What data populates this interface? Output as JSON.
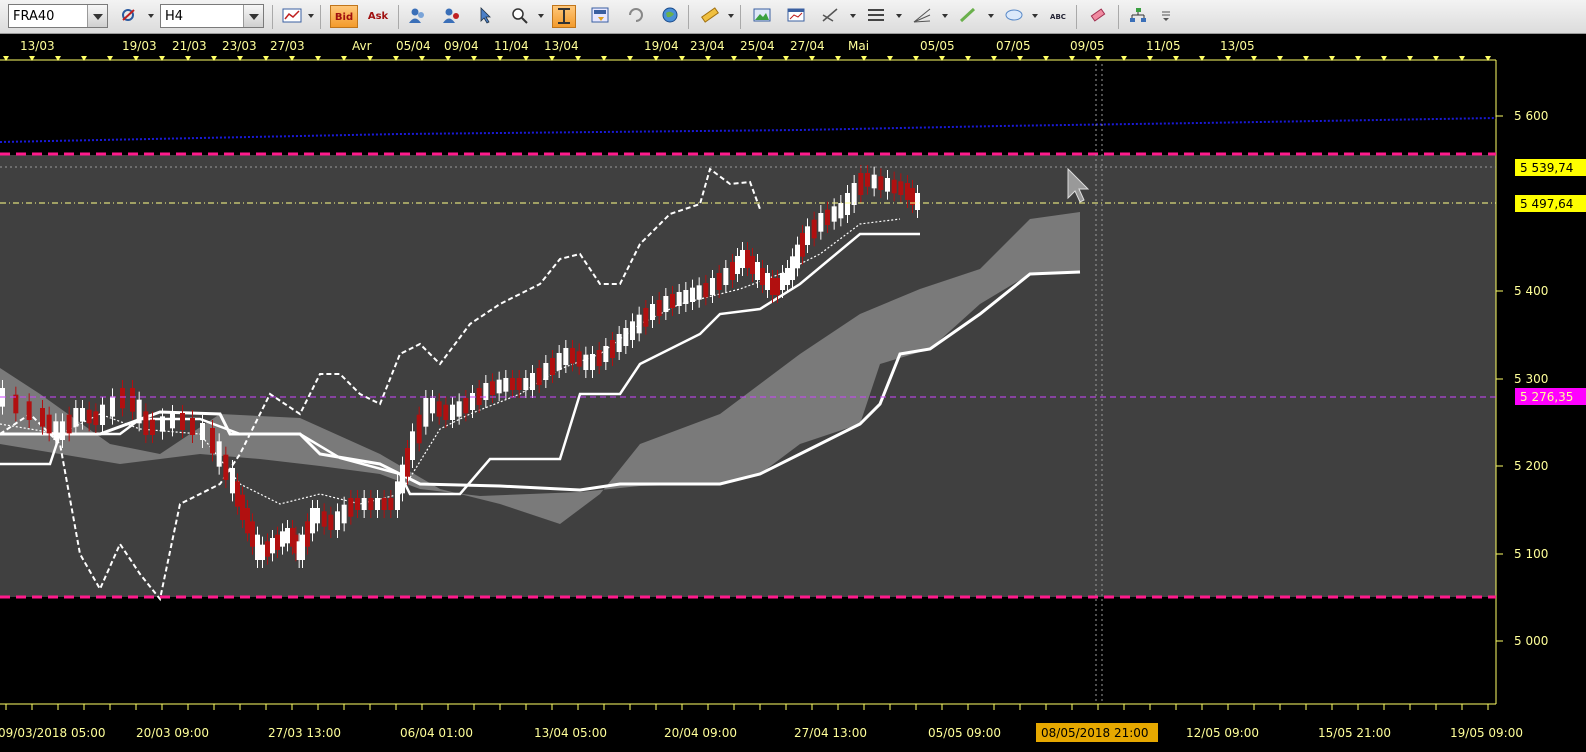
{
  "toolbar": {
    "symbol": "FRA40",
    "timeframe": "H4",
    "bid_label": "Bid",
    "ask_label": "Ask",
    "abc_label": "ABC",
    "icons": [
      "instrument-icon",
      "line-chart-icon",
      "bid-icon",
      "ask-icon",
      "users-icon",
      "users2-icon",
      "cursor-icon",
      "zoom-icon",
      "autoscale-icon",
      "save-icon",
      "refresh-icon",
      "globe-icon",
      "ruler-icon",
      "image-icon",
      "window-icon",
      "crosshair-tool-icon",
      "lines-icon",
      "fan-icon",
      "pencil-icon",
      "ellipse-icon",
      "text-icon",
      "eraser-icon",
      "hierarchy-icon",
      "more-icon"
    ]
  },
  "top_axis_labels": [
    "13/03",
    "19/03",
    "21/03",
    "23/03",
    "27/03",
    "Avr",
    "05/04",
    "09/04",
    "11/04",
    "13/04",
    "19/04",
    "23/04",
    "25/04",
    "27/04",
    "Mai",
    "05/05",
    "07/05",
    "09/05",
    "11/05",
    "13/05"
  ],
  "bottom_axis_labels": [
    "09/03/2018 05:00",
    "20/03 09:00",
    "27/03 13:00",
    "06/04 01:00",
    "13/04 05:00",
    "20/04 09:00",
    "27/04 13:00",
    "05/05 09:00",
    "12/05 09:00",
    "15/05 21:00",
    "19/05 09:00"
  ],
  "cursor_time_label": "08/05/2018 21:00",
  "price_axis": [
    "5 600",
    "5 400",
    "5 300",
    "5 200",
    "5 100",
    "5 000"
  ],
  "price_tags": {
    "resistance": "5 539,74",
    "last": "5 497,64",
    "support": "5 276,35"
  },
  "colors": {
    "bg": "#000000",
    "range_fill": "#404040",
    "axis_text": "#ffff99",
    "magenta_line": "#ff1a8c",
    "support_tag_bg": "#ff00ff",
    "price_tag_bg": "#ffff00",
    "cloud": "#7a7a7a",
    "bull_candle": "#ffffff",
    "bear_candle": "#b11010",
    "sma_line": "#0000cc"
  },
  "chart_data": {
    "type": "candlestick",
    "instrument": "FRA40",
    "timeframe": "H4",
    "price_range": [
      4930,
      5640
    ],
    "horizontal_levels": [
      {
        "value": 5558,
        "style": "dashed-magenta"
      },
      {
        "value": 5050,
        "style": "dashed-magenta"
      },
      {
        "value": 5539.74,
        "style": "dotted-grey"
      },
      {
        "value": 5497.64,
        "style": "dash-dot-yellow"
      },
      {
        "value": 5276.35,
        "style": "dashed-violet"
      }
    ],
    "indicator": "ichimoku"
  }
}
